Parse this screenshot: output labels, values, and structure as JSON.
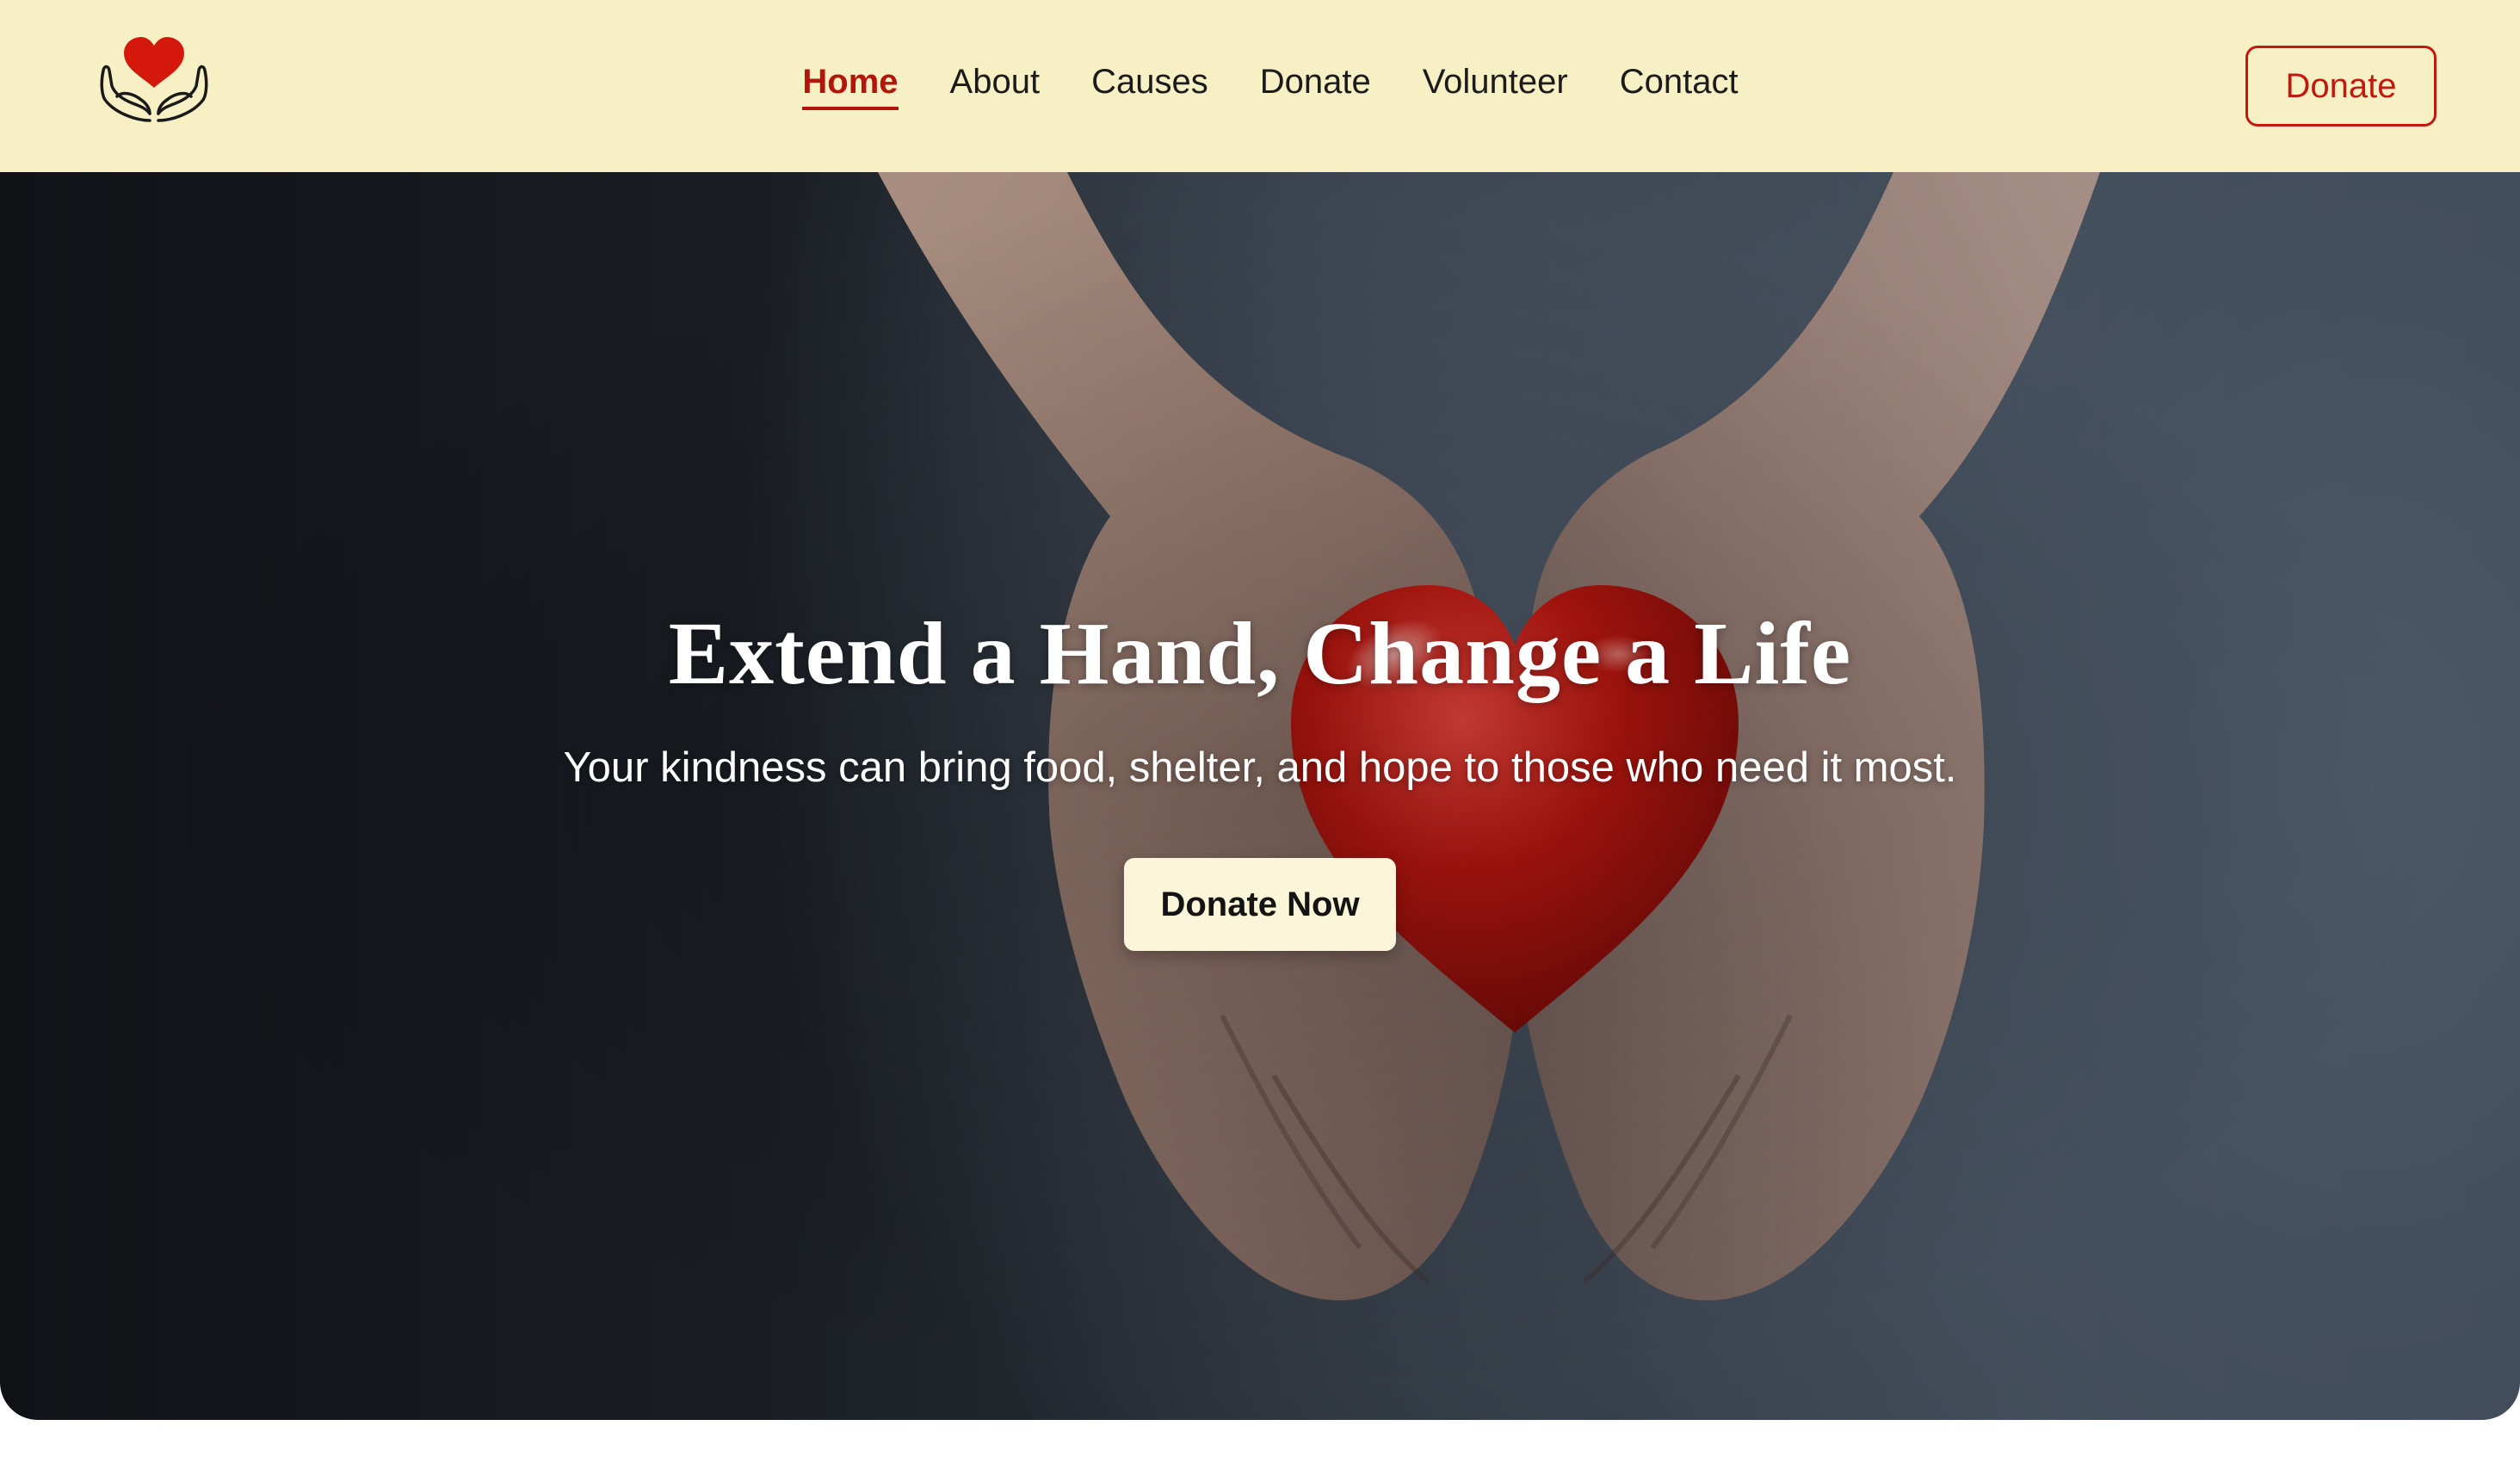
{
  "brand": {
    "logo_icon": "heart-in-hands-icon",
    "heart_color": "#d4190c",
    "outline_color": "#1a1a1a"
  },
  "nav": {
    "items": [
      {
        "label": "Home",
        "active": true
      },
      {
        "label": "About",
        "active": false
      },
      {
        "label": "Causes",
        "active": false
      },
      {
        "label": "Donate",
        "active": false
      },
      {
        "label": "Volunteer",
        "active": false
      },
      {
        "label": "Contact",
        "active": false
      }
    ],
    "donate_button": "Donate"
  },
  "hero": {
    "title": "Extend a Hand, Change a Life",
    "subtitle": "Your kindness can bring food, shelter, and hope to those who need it most.",
    "cta": "Donate Now",
    "image_subject": "hands-holding-red-heart"
  },
  "colors": {
    "header_bg": "#f8f0c5",
    "accent": "#b3150b",
    "cta_bg": "#fbf5d9"
  }
}
